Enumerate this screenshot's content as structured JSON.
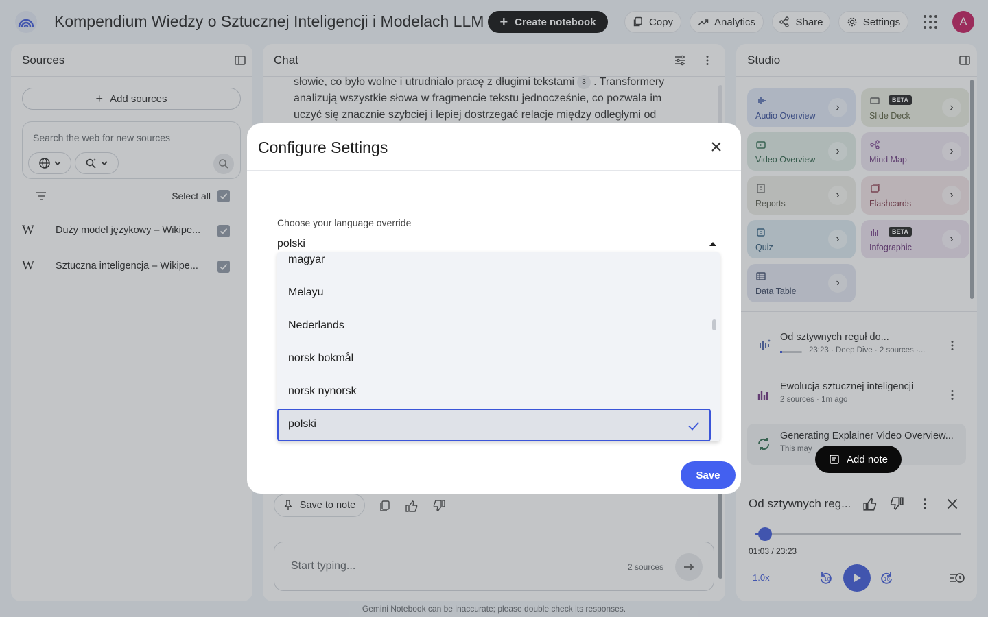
{
  "header": {
    "title": "Kompendium Wiedzy o Sztucznej Inteligencji i Modelach LLM",
    "create_label": "Create notebook",
    "copy_label": "Copy",
    "analytics_label": "Analytics",
    "share_label": "Share",
    "settings_label": "Settings",
    "avatar_letter": "A"
  },
  "sources": {
    "title": "Sources",
    "add_label": "Add sources",
    "search_placeholder": "Search the web for new sources",
    "select_all": "Select all",
    "items": [
      {
        "icon": "W",
        "label": "Duży model językowy – Wikipe..."
      },
      {
        "icon": "W",
        "label": "Sztuczna inteligencja – Wikipe..."
      }
    ]
  },
  "chat": {
    "title": "Chat",
    "line1": "słowie, co było wolne i utrudniało pracę z długimi tekstami",
    "cite": "3",
    "line1b": ". Transformery",
    "line2": "analizują wszystkie słowa w fragmencie tekstu jednocześnie, co pozwala im",
    "line3": "uczyć się znacznie szybciej i lepiej dostrzegać relacje między odległymi od",
    "save_to_note": "Save to note",
    "input_placeholder": "Start typing...",
    "source_count": "2 sources"
  },
  "studio": {
    "title": "Studio",
    "tiles": [
      {
        "label": "Audio Overview"
      },
      {
        "label": "Slide Deck",
        "badge": "BETA"
      },
      {
        "label": "Video Overview"
      },
      {
        "label": "Mind Map"
      },
      {
        "label": "Reports"
      },
      {
        "label": "Flashcards"
      },
      {
        "label": "Quiz"
      },
      {
        "label": "Infographic",
        "badge": "BETA"
      },
      {
        "label": "Data Table"
      }
    ],
    "notes": [
      {
        "title": "Od sztywnych reguł do...",
        "sub": "23:23 · Deep Dive · 2 sources ·..."
      },
      {
        "title": "Ewolucja sztucznej inteligencji",
        "sub": "2 sources · 1m ago"
      },
      {
        "title": "Generating Explainer Video Overview...",
        "sub": "This may"
      }
    ],
    "add_note": "Add note"
  },
  "player": {
    "title": "Od sztywnych reg...",
    "time": "01:03 / 23:23",
    "progress": 0.045,
    "speed": "1.0x"
  },
  "modal": {
    "title": "Configure Settings",
    "label": "Choose your language override",
    "value": "polski",
    "options": [
      "magyar",
      "Melayu",
      "Nederlands",
      "norsk bokmål",
      "norsk nynorsk",
      "polski"
    ],
    "selected": "polski",
    "save": "Save"
  },
  "footer": "Gemini Notebook can be inaccurate; please double check its responses.",
  "colors": {
    "accent": "#4360f0",
    "audio_tile": "#dfe7f6",
    "slide_tile": "#e9ece0",
    "video_tile": "#dfece6",
    "mindmap_tile": "#ece4f0",
    "reports_tile": "#ecece5",
    "flashcards_tile": "#f1e3e6",
    "quiz_tile": "#dbe9f0",
    "infographic_tile": "#ebe1ee",
    "datatable_tile": "#e2e6f1"
  }
}
